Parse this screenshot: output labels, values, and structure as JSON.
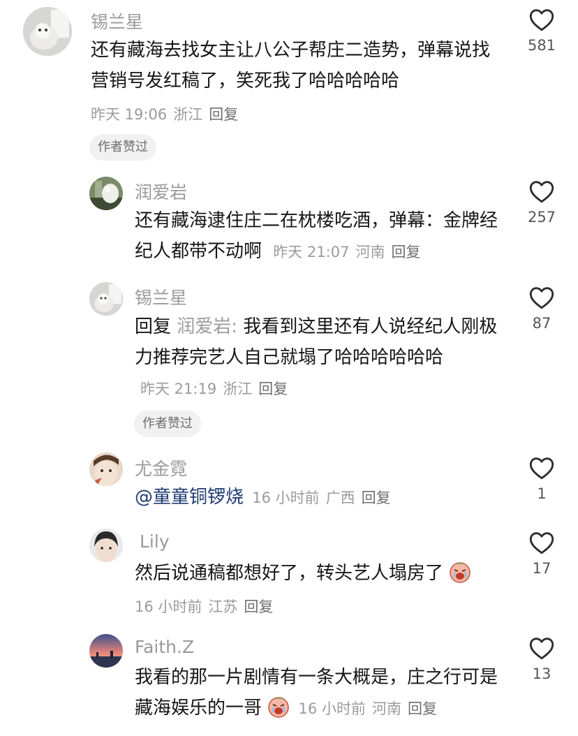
{
  "comments": [
    {
      "username": "锡兰星",
      "text": "还有藏海去找女主让八公子帮庄二造势，弹幕说找营销号发红稿了，笑死我了哈哈哈哈哈",
      "time": "昨天 19:06",
      "location": "浙江",
      "reply_label": "回复",
      "badge": "作者赞过",
      "likes": "581"
    },
    {
      "username": "润爱岩",
      "text": "还有藏海逮住庄二在枕楼吃酒，弹幕：金牌经纪人都带不动啊",
      "time": "昨天 21:07",
      "location": "河南",
      "reply_label": "回复",
      "likes": "257"
    },
    {
      "username": "锡兰星",
      "reply_prefix": "回复",
      "reply_to": "润爱岩:",
      "text": "我看到这里还有人说经纪人刚极力推荐完艺人自己就塌了哈哈哈哈哈哈",
      "time": "昨天 21:19",
      "location": "浙江",
      "reply_label": "回复",
      "badge": "作者赞过",
      "likes": "87"
    },
    {
      "username": "尤金霓",
      "mention": "@童童铜锣烧",
      "time": "16 小时前",
      "location": "广西",
      "reply_label": "回复",
      "likes": "1"
    },
    {
      "username": "Lily",
      "text": "然后说通稿都想好了，转头艺人塌房了",
      "emoji": "crying-face-icon",
      "time": "16 小时前",
      "location": "江苏",
      "reply_label": "回复",
      "likes": "17"
    },
    {
      "username": "Faith.Z",
      "text": "我看的那一片剧情有一条大概是，庄之行可是藏海娱乐的一哥",
      "emoji": "crying-face-icon",
      "time": "16 小时前",
      "location": "河南",
      "reply_label": "回复",
      "likes": "13"
    }
  ]
}
